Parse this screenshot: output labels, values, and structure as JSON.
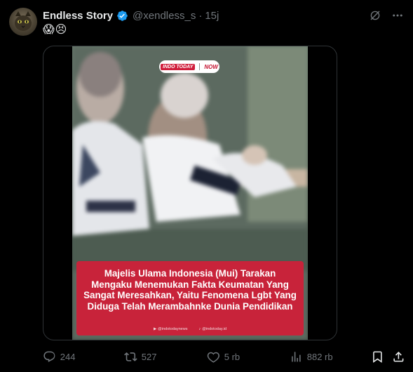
{
  "tweet": {
    "display_name": "Endless Story",
    "handle": "@xendless_s",
    "separator": "·",
    "time": "15j",
    "text": "😱😣"
  },
  "media": {
    "logo_left": "INDO TODAY",
    "logo_right": "NOW",
    "caption": "Majelis Ulama Indonesia (Mui) Tarakan Mengaku Menemukan Fakta Keumatan Yang Sangat Meresahkan, Yaitu Fenomena Lgbt Yang Diduga Telah Merambahnke Dunia Pendidikan",
    "footer_youtube": "@indotodaynews",
    "footer_tiktok": "@indotoday.id"
  },
  "actions": {
    "replies": "244",
    "retweets": "527",
    "likes": "5 rb",
    "views": "882 rb"
  },
  "icons": {
    "verified": "verified-badge-icon",
    "grok": "grok-icon",
    "more": "more-icon",
    "reply": "reply-icon",
    "retweet": "retweet-icon",
    "like": "heart-icon",
    "views": "views-icon",
    "bookmark": "bookmark-icon",
    "share": "share-icon"
  },
  "colors": {
    "background": "#000000",
    "text_primary": "#e7e9ea",
    "text_secondary": "#71767b",
    "verified": "#1d9bf0",
    "caption_bg": "#c8233a"
  }
}
